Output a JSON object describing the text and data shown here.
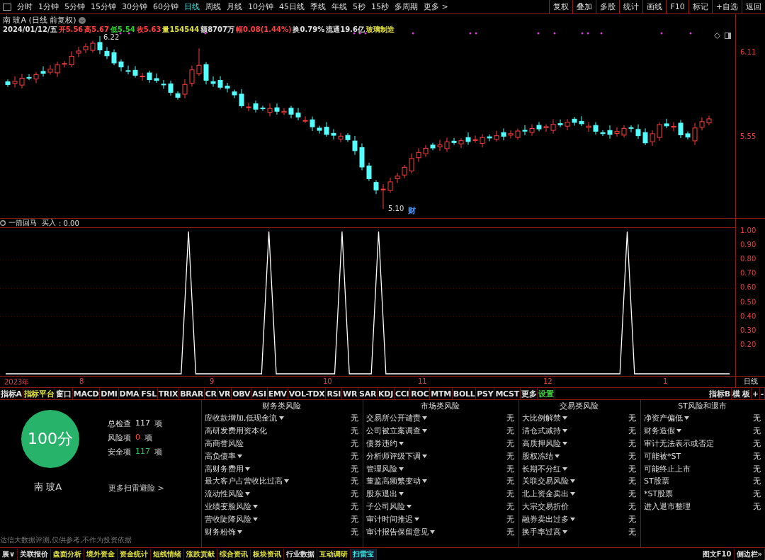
{
  "period_tabs": [
    {
      "label": "分时",
      "selected": false
    },
    {
      "label": "1分钟",
      "selected": false
    },
    {
      "label": "5分钟",
      "selected": false
    },
    {
      "label": "15分钟",
      "selected": false
    },
    {
      "label": "30分钟",
      "selected": false
    },
    {
      "label": "60分钟",
      "selected": false
    },
    {
      "label": "日线",
      "selected": true
    },
    {
      "label": "周线",
      "selected": false
    },
    {
      "label": "月线",
      "selected": false
    },
    {
      "label": "10分钟",
      "selected": false
    },
    {
      "label": "45日线",
      "selected": false
    },
    {
      "label": "季线",
      "selected": false
    },
    {
      "label": "年线",
      "selected": false
    },
    {
      "label": "5秒",
      "selected": false
    },
    {
      "label": "15秒",
      "selected": false
    },
    {
      "label": "多周期",
      "selected": false
    },
    {
      "label": "更多 >",
      "selected": false
    }
  ],
  "toolbar_buttons": [
    "复权",
    "叠加",
    "多股",
    "统计",
    "画线",
    "F10",
    "标记",
    "+自选",
    "返回"
  ],
  "main_chart": {
    "title": "南 玻A (日线 前复权)",
    "quote": [
      {
        "text": "2024/01/12/五",
        "color": "#e0e0e0"
      },
      {
        "text": "开5.56",
        "color": "#ff4040"
      },
      {
        "text": "高5.67",
        "color": "#ff4040"
      },
      {
        "text": "低5.54",
        "color": "#30d030"
      },
      {
        "text": "收5.63",
        "color": "#ff4040"
      },
      {
        "text": "量154544",
        "color": "#e0e040"
      },
      {
        "text": "额8707万",
        "color": "#e0e0e0"
      },
      {
        "text": "幅0.08(1.44%)",
        "color": "#ff4040"
      },
      {
        "text": "换0.79%",
        "color": "#e0e0e0"
      },
      {
        "text": "流通19.6亿",
        "color": "#e0e0e0"
      },
      {
        "text": "玻璃制造",
        "color": "#e0e040"
      }
    ],
    "price_labels": [
      {
        "text": "6.22",
        "kind": "high"
      },
      {
        "text": "5.10",
        "kind": "low"
      }
    ],
    "event_badge": "财",
    "axis_labels": [
      "6.11",
      "5.55"
    ]
  },
  "indicator": {
    "title": "一箭回马",
    "readout": ": 0.00",
    "x_axis_labels": [
      "2023年",
      "8",
      "9",
      "10",
      "11",
      "12",
      "1"
    ],
    "chart_data": {
      "type": "line",
      "series": [
        {
          "name": "买入",
          "color": "#ffffff",
          "values": [
            0,
            0,
            0,
            0,
            0,
            0,
            0,
            0,
            0,
            0,
            0,
            0,
            0,
            0,
            0,
            0,
            0,
            0,
            0,
            0,
            0,
            0,
            0,
            0,
            0,
            1,
            0,
            0,
            0,
            0,
            0,
            0,
            0,
            0,
            0,
            0,
            1,
            0,
            0,
            0,
            0,
            0,
            0,
            0,
            0,
            0,
            1,
            0,
            0,
            0,
            0,
            1,
            0,
            0,
            0,
            0,
            0,
            0,
            0,
            0,
            0,
            0,
            0,
            0,
            0,
            0,
            0,
            0,
            0,
            0,
            0,
            0,
            0,
            0,
            0,
            0,
            0,
            0,
            0,
            0,
            0,
            0,
            0,
            0,
            0,
            1,
            0,
            0,
            0,
            0,
            0,
            0,
            0,
            0,
            0,
            0,
            0,
            0,
            0,
            0
          ]
        }
      ],
      "grid": true,
      "ylim": [
        0,
        1
      ],
      "yticks": [
        {
          "value": 1,
          "label": "1.00"
        },
        {
          "value": 0.9,
          "label": "0.90"
        },
        {
          "value": 0.8,
          "label": "0.80"
        },
        {
          "value": 0.7,
          "label": "0.70"
        },
        {
          "value": 0.6,
          "label": "0.60"
        },
        {
          "value": 0.5,
          "label": "0.50"
        },
        {
          "value": 0.4,
          "label": "0.40"
        },
        {
          "value": 0.3,
          "label": "0.30"
        },
        {
          "value": 0.2,
          "label": "0.20"
        }
      ]
    },
    "period_label": "日线"
  },
  "indicator_tabs": [
    {
      "label": "指标A",
      "color": "#e0e0e0"
    },
    {
      "label": "指标平台",
      "color": "#e0e040"
    },
    {
      "label": "窗口",
      "color": "#e0e0e0"
    },
    {
      "label": "MACD",
      "color": "#e0e0e0"
    },
    {
      "label": "DMI",
      "color": "#e0e0e0"
    },
    {
      "label": "DMA",
      "color": "#e0e0e0"
    },
    {
      "label": "FSL",
      "color": "#e0e0e0"
    },
    {
      "label": "TRIX",
      "color": "#e0e0e0"
    },
    {
      "label": "BRAR",
      "color": "#e0e0e0"
    },
    {
      "label": "CR",
      "color": "#e0e0e0"
    },
    {
      "label": "VR",
      "color": "#e0e0e0"
    },
    {
      "label": "OBV",
      "color": "#e0e0e0"
    },
    {
      "label": "ASI",
      "color": "#e0e0e0"
    },
    {
      "label": "EMV",
      "color": "#e0e0e0"
    },
    {
      "label": "VOL-TDX",
      "color": "#e0e0e0"
    },
    {
      "label": "RSI",
      "color": "#e0e0e0"
    },
    {
      "label": "WR",
      "color": "#e0e0e0"
    },
    {
      "label": "SAR",
      "color": "#e0e0e0"
    },
    {
      "label": "KDJ",
      "color": "#e0e0e0"
    },
    {
      "label": "CCI",
      "color": "#e0e0e0"
    },
    {
      "label": "ROC",
      "color": "#e0e0e0"
    },
    {
      "label": "MTM",
      "color": "#e0e0e0"
    },
    {
      "label": "BOLL",
      "color": "#e0e0e0"
    },
    {
      "label": "PSY",
      "color": "#e0e0e0"
    },
    {
      "label": "MCST",
      "color": "#e0e0e0"
    },
    {
      "label": "更多",
      "color": "#e0e0e0"
    },
    {
      "label": "设置",
      "color": "#40d040"
    }
  ],
  "indicator_tools": [
    "指标B",
    "模 板",
    "+",
    "-"
  ],
  "risk_scan": {
    "score": "100分",
    "stock": "南 玻A",
    "summary": [
      {
        "label": "总检查",
        "count": "117",
        "unit": "项",
        "color": "#e0e0e0"
      },
      {
        "label": "风险项",
        "count": "0",
        "unit": "项",
        "color": "#ff5030"
      },
      {
        "label": "安全项",
        "count": "117",
        "unit": "项",
        "color": "#30c060"
      }
    ],
    "more_link": "更多扫雷避险 >",
    "disclaimer": "达信大数据评测,仅供参考,不作为投资依据",
    "categories": [
      {
        "title": "财务类风险",
        "items": [
          {
            "name": "应收款增加,低现金流",
            "dropdown": true,
            "result": "无"
          },
          {
            "name": "高研发费用资本化",
            "dropdown": false,
            "result": "无"
          },
          {
            "name": "高商誉风险",
            "dropdown": false,
            "result": "无"
          },
          {
            "name": "高负债率",
            "dropdown": true,
            "result": "无"
          },
          {
            "name": "高财务费用",
            "dropdown": true,
            "result": "无"
          },
          {
            "name": "最大客户占营收比过高",
            "dropdown": true,
            "result": "无"
          },
          {
            "name": "流动性风险",
            "dropdown": true,
            "result": "无"
          },
          {
            "name": "业绩变脸风险",
            "dropdown": true,
            "result": "无"
          },
          {
            "name": "营收陡降风险",
            "dropdown": true,
            "result": "无"
          },
          {
            "name": "财务粉饰",
            "dropdown": true,
            "result": "无"
          }
        ]
      },
      {
        "title": "市场类风险",
        "items": [
          {
            "name": "交易所公开谴责",
            "dropdown": true,
            "result": "无"
          },
          {
            "name": "公司被立案调查",
            "dropdown": true,
            "result": "无"
          },
          {
            "name": "债券违约",
            "dropdown": true,
            "result": "无"
          },
          {
            "name": "分析师评级下调",
            "dropdown": true,
            "result": "无"
          },
          {
            "name": "管理风险",
            "dropdown": true,
            "result": "无"
          },
          {
            "name": "董监高频繁变动",
            "dropdown": true,
            "result": "无"
          },
          {
            "name": "股东退出",
            "dropdown": true,
            "result": "无"
          },
          {
            "name": "子公司风险",
            "dropdown": true,
            "result": "无"
          },
          {
            "name": "审计时间推迟",
            "dropdown": true,
            "result": "无"
          },
          {
            "name": "审计报告保留意见",
            "dropdown": true,
            "result": "无"
          }
        ]
      },
      {
        "title": "交易类风险",
        "items": [
          {
            "name": "大比例解禁",
            "dropdown": true,
            "result": "无"
          },
          {
            "name": "清仓式减持",
            "dropdown": true,
            "result": "无"
          },
          {
            "name": "高质押风险",
            "dropdown": true,
            "result": "无"
          },
          {
            "name": "股权冻结",
            "dropdown": true,
            "result": "无"
          },
          {
            "name": "长期不分红",
            "dropdown": true,
            "result": "无"
          },
          {
            "name": "关联交易风险",
            "dropdown": true,
            "result": "无"
          },
          {
            "name": "北上资金卖出",
            "dropdown": true,
            "result": "无"
          },
          {
            "name": "大宗交易折价",
            "dropdown": false,
            "result": "无"
          },
          {
            "name": "融券卖出过多",
            "dropdown": true,
            "result": "无"
          },
          {
            "name": "换手率过高",
            "dropdown": true,
            "result": "无"
          }
        ]
      },
      {
        "title": "ST风险和退市",
        "items": [
          {
            "name": "净资产偏低",
            "dropdown": true,
            "result": "无"
          },
          {
            "name": "财务造假",
            "dropdown": true,
            "result": "无"
          },
          {
            "name": "审计无法表示或否定",
            "dropdown": false,
            "result": "无"
          },
          {
            "name": "可能被*ST",
            "dropdown": false,
            "result": "无"
          },
          {
            "name": "可能终止上市",
            "dropdown": false,
            "result": "无"
          },
          {
            "name": "ST股票",
            "dropdown": false,
            "result": "无"
          },
          {
            "name": "*ST股票",
            "dropdown": false,
            "result": "无"
          },
          {
            "name": "进入退市整理",
            "dropdown": false,
            "result": "无"
          }
        ]
      }
    ]
  },
  "bottom_tabs": [
    {
      "label": "展∨",
      "color": "#e0e0e0",
      "selected": false
    },
    {
      "label": "关联报价",
      "color": "#e0e0e0",
      "selected": false
    },
    {
      "label": "盘面分析",
      "color": "#e0e040",
      "selected": false
    },
    {
      "label": "境外资金",
      "color": "#e0e040",
      "selected": false
    },
    {
      "label": "资金统计",
      "color": "#e0e040",
      "selected": false
    },
    {
      "label": "短线情绪",
      "color": "#e0e040",
      "selected": false
    },
    {
      "label": "涨跌贡献",
      "color": "#e0e040",
      "selected": false
    },
    {
      "label": "综合资讯",
      "color": "#e0e040",
      "selected": false
    },
    {
      "label": "板块资讯",
      "color": "#e0e040",
      "selected": false
    },
    {
      "label": "行业数据",
      "color": "#e0e0e0",
      "selected": false
    },
    {
      "label": "互动调研",
      "color": "#e0e040",
      "selected": false
    },
    {
      "label": "扫雷宝",
      "color": "#40e0e0",
      "selected": true
    }
  ],
  "bottom_right": [
    "图文F10",
    "侧边栏»"
  ]
}
